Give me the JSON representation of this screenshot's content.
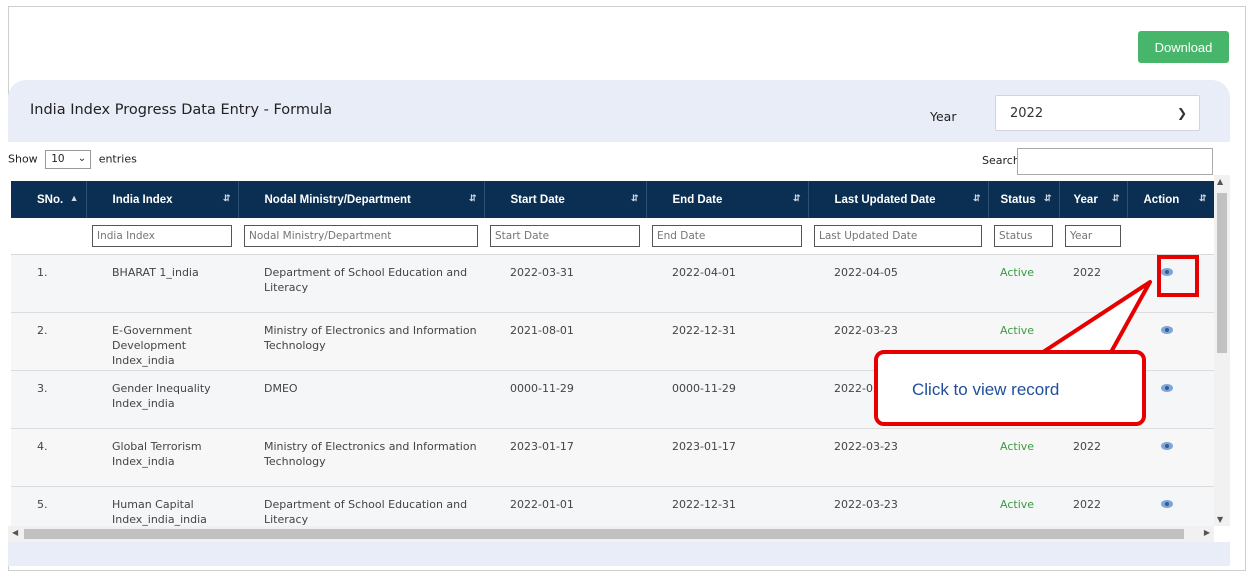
{
  "toolbar": {
    "download_label": "Download"
  },
  "panel": {
    "title": "India Index Progress Data Entry - Formula",
    "year_label": "Year",
    "year_value": "2022"
  },
  "datatable": {
    "show_label": "Show",
    "page_length": "10",
    "entries_label": "entries",
    "search_label": "Search:",
    "columns": [
      "SNo.",
      "India Index",
      "Nodal Ministry/Department",
      "Start Date",
      "End Date",
      "Last Updated Date",
      "Status",
      "Year",
      "Action"
    ],
    "filters": [
      "",
      "India Index",
      "Nodal Ministry/Department",
      "Start Date",
      "End Date",
      "Last Updated Date",
      "Status",
      "Year",
      ""
    ],
    "rows": [
      {
        "sno": "1.",
        "index": "BHARAT 1_india",
        "ministry": "Department of School Education and Literacy",
        "start": "2022-03-31",
        "end": "2022-04-01",
        "updated": "2022-04-05",
        "status": "Active",
        "year": "2022"
      },
      {
        "sno": "2.",
        "index": "E-Government Development Index_india",
        "ministry": "Ministry of Electronics and Information Technology",
        "start": "2021-08-01",
        "end": "2022-12-31",
        "updated": "2022-03-23",
        "status": "Active",
        "year": ""
      },
      {
        "sno": "3.",
        "index": "Gender Inequality Index_india",
        "ministry": "DMEO",
        "start": "0000-11-29",
        "end": "0000-11-29",
        "updated": "2022-03-",
        "status": "",
        "year": ""
      },
      {
        "sno": "4.",
        "index": "Global Terrorism Index_india",
        "ministry": "Ministry of Electronics and Information Technology",
        "start": "2023-01-17",
        "end": "2023-01-17",
        "updated": "2022-03-23",
        "status": "Active",
        "year": "2022"
      },
      {
        "sno": "5.",
        "index": "Human Capital Index_india_india",
        "ministry": "Department of School Education and Literacy",
        "start": "2022-01-01",
        "end": "2022-12-31",
        "updated": "2022-03-23",
        "status": "Active",
        "year": "2022"
      }
    ]
  },
  "annotation": {
    "callout_text": "Click to view  record",
    "color": "#e60000"
  },
  "icons": {
    "view": "eye-icon",
    "sort": "sort-icon"
  },
  "colors": {
    "header_bg": "#0b2f52",
    "download_bg": "#48b66a",
    "status_active": "#3a9b41"
  }
}
